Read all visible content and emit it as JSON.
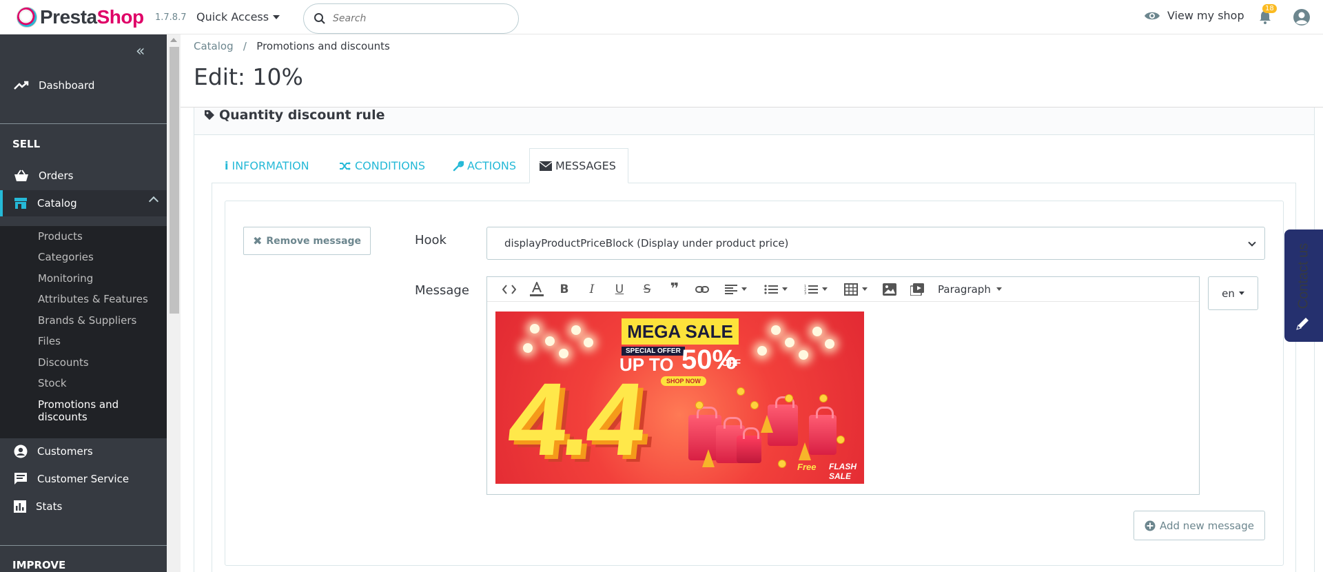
{
  "header": {
    "logo_text_1": "Presta",
    "logo_text_2": "Shop",
    "version": "1.7.8.7",
    "quick_access": "Quick Access",
    "search_placeholder": "Search",
    "view_shop": "View my shop",
    "notifications_count": "18"
  },
  "sidebar": {
    "dashboard": "Dashboard",
    "sell_title": "SELL",
    "orders": "Orders",
    "catalog": "Catalog",
    "catalog_sub": [
      "Products",
      "Categories",
      "Monitoring",
      "Attributes & Features",
      "Brands & Suppliers",
      "Files",
      "Discounts",
      "Stock",
      "Promotions and",
      "discounts"
    ],
    "customers": "Customers",
    "customer_service": "Customer Service",
    "stats": "Stats",
    "improve_title": "IMPROVE"
  },
  "breadcrumb": {
    "root": "Catalog",
    "sep": "/",
    "current": "Promotions and discounts"
  },
  "page_title": "Edit: 10%",
  "card": {
    "title": "Quantity discount rule",
    "tabs": [
      "INFORMATION",
      "CONDITIONS",
      "ACTIONS",
      "MESSAGES"
    ],
    "active_tab": "MESSAGES",
    "remove_message": "Remove message",
    "hook_label": "Hook",
    "hook_value": "displayProductPriceBlock (Display under product price)",
    "message_label": "Message",
    "paragraph": "Paragraph",
    "lang": "en",
    "add_message": "Add new message"
  },
  "banner": {
    "mega_sale": "MEGA SALE",
    "special_offer": "SPECIAL OFFER",
    "up_to": "UP TO",
    "percent": "50%",
    "off": "OFF",
    "shop_now": "SHOP NOW",
    "big_number": "4.4",
    "free_delivery": "Free",
    "flash_sale": "FLASH SALE"
  },
  "contact": {
    "label": "Contact us"
  },
  "colors": {
    "accent": "#25b9d7",
    "sidebar_bg": "#363a41",
    "brand_pink": "#df0067",
    "contact_bg": "#25306e"
  }
}
